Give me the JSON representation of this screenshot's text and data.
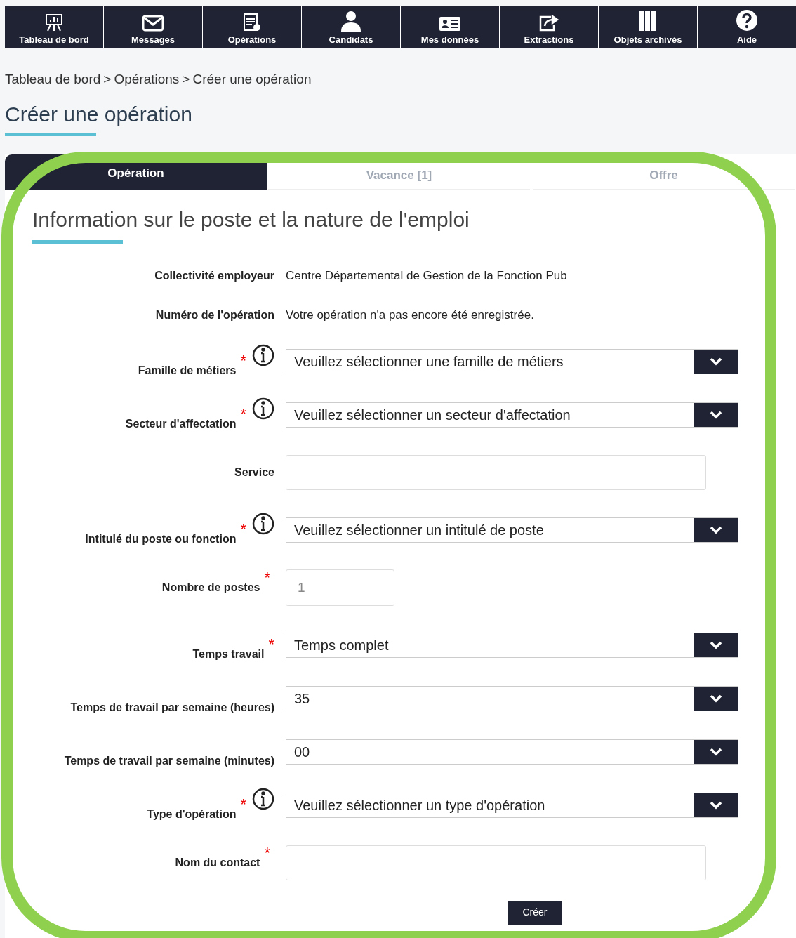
{
  "nav": [
    {
      "label": "Tableau de bord",
      "kind": "chart"
    },
    {
      "label": "Messages",
      "kind": "mail"
    },
    {
      "label": "Opérations",
      "kind": "clipboard"
    },
    {
      "label": "Candidats",
      "kind": "person"
    },
    {
      "label": "Mes données",
      "kind": "card"
    },
    {
      "label": "Extractions",
      "kind": "share"
    },
    {
      "label": "Objets archivés",
      "kind": "archive"
    },
    {
      "label": "Aide",
      "kind": "help"
    }
  ],
  "breadcrumb": [
    "Tableau de bord",
    "Opérations",
    "Créer une opération"
  ],
  "breadcrumb_separator": ">",
  "page_title": "Créer une opération",
  "tabs": [
    {
      "label": "Opération",
      "selected": true
    },
    {
      "label": "Vacance [1]",
      "selected": false
    },
    {
      "label": "Offre",
      "selected": false
    }
  ],
  "section_title": "Information sur le poste et la nature de l'emploi",
  "fields": [
    {
      "label": "Collectivité employeur",
      "kind": "static",
      "value": "Centre Départemental de Gestion de la Fonction Pub",
      "required": false,
      "info": false
    },
    {
      "label": "Numéro de l'opération",
      "kind": "static",
      "value": "Votre opération n'a pas encore été enregistrée.",
      "required": false,
      "info": false
    },
    {
      "label": "Famille de métiers",
      "kind": "select",
      "value": "Veuillez sélectionner une famille de métiers",
      "required": true,
      "info": true
    },
    {
      "label": "Secteur d'affectation",
      "kind": "select",
      "value": "Veuillez sélectionner un secteur d'affectation",
      "required": true,
      "info": true
    },
    {
      "label": "Service",
      "kind": "text",
      "required": false,
      "info": false
    },
    {
      "label": "Intitulé du poste ou fonction",
      "kind": "select",
      "value": "Veuillez sélectionner un intitulé de poste",
      "required": true,
      "info": true
    },
    {
      "label": "Nombre de postes",
      "kind": "number",
      "placeholder": "1",
      "required": true,
      "info": false
    },
    {
      "label": "Temps travail",
      "kind": "select",
      "value": "Temps complet",
      "required": true,
      "info": false
    },
    {
      "label": "Temps de travail par semaine (heures)",
      "kind": "select",
      "value": "35",
      "required": false,
      "info": false
    },
    {
      "label": "Temps de travail par semaine (minutes)",
      "kind": "select",
      "value": "00",
      "required": false,
      "info": false
    },
    {
      "label": "Type d'opération",
      "kind": "select",
      "value": "Veuillez sélectionner un type d'opération",
      "required": true,
      "info": true
    },
    {
      "label": "Nom du contact",
      "kind": "text",
      "required": true,
      "info": false
    }
  ],
  "required_mark": "*",
  "submit": "Créer"
}
